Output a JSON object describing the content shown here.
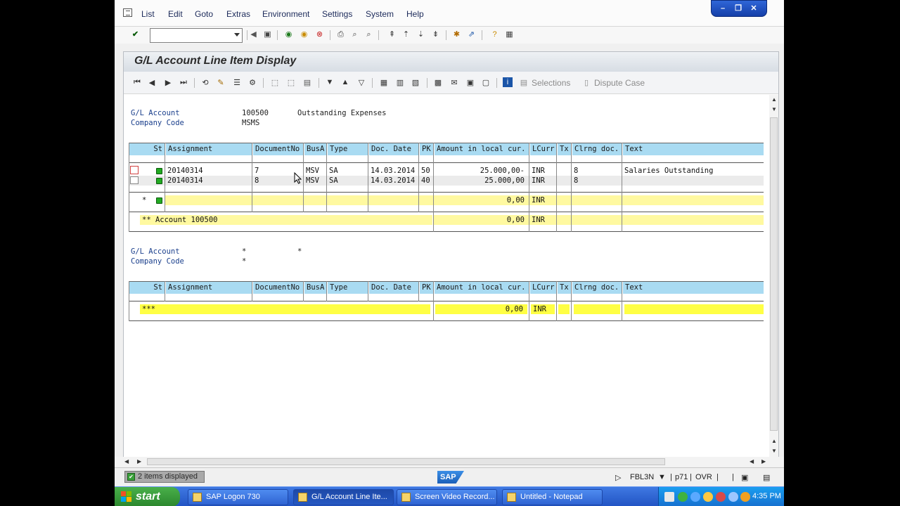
{
  "menubar": {
    "items": [
      "List",
      "Edit",
      "Goto",
      "Extras",
      "Environment",
      "Settings",
      "System",
      "Help"
    ],
    "underline": [
      "L",
      "E",
      "G",
      "x",
      "v",
      "S",
      "y",
      "H"
    ]
  },
  "command_field": {
    "value": ""
  },
  "screen": {
    "title": "G/L Account Line Item Display",
    "toolbar": {
      "selections_label": "Selections",
      "dispute_label": "Dispute Case"
    }
  },
  "block1": {
    "gl_account_label": "G/L Account",
    "gl_account_value": "100500",
    "gl_account_desc": "Outstanding Expenses",
    "company_code_label": "Company Code",
    "company_code_value": "MSMS"
  },
  "columns": [
    "St",
    "Assignment",
    "DocumentNo",
    "BusA",
    "Type",
    "Doc. Date",
    "PK",
    "Amount in local cur.",
    "LCurr",
    "Tx",
    "Clrng doc.",
    "Text"
  ],
  "rows": [
    {
      "assignment": "20140314",
      "doc_no": "7",
      "busa": "MSV",
      "type": "SA",
      "doc_date": "14.03.2014",
      "pk": "50",
      "amount": "25.000,00-",
      "lcurr": "INR",
      "tx": "",
      "clrng": "8",
      "text": "Salaries Outstanding"
    },
    {
      "assignment": "20140314",
      "doc_no": "8",
      "busa": "MSV",
      "type": "SA",
      "doc_date": "14.03.2014",
      "pk": "40",
      "amount": "25.000,00",
      "lcurr": "INR",
      "tx": "",
      "clrng": "8",
      "text": ""
    }
  ],
  "subtotal1": {
    "marker": "*",
    "amount": "0,00",
    "lcurr": "INR"
  },
  "account_total": {
    "label": "** Account 100500",
    "amount": "0,00",
    "lcurr": "INR"
  },
  "block2": {
    "gl_account_label": "G/L Account",
    "gl_account_value": "*",
    "gl_account_extra": "*",
    "company_code_label": "Company Code",
    "company_code_value": "*"
  },
  "grand_total": {
    "label": "***",
    "amount": "0,00",
    "lcurr": "INR"
  },
  "statusbar": {
    "message": "2 items displayed",
    "logo": "SAP",
    "transaction": "FBL3N",
    "server": "p71",
    "mode": "OVR"
  },
  "taskbar": {
    "start": "start",
    "tasks": [
      "SAP Logon 730",
      "G/L Account Line Ite...",
      "Screen Video Record...",
      "Untitled - Notepad"
    ],
    "clock": "4:35 PM"
  },
  "colors": {
    "header_blue": "#a9dbf2",
    "total_yellow": "#ffff44",
    "label_blue": "#1a3f8c",
    "led_green": "#22aa22",
    "taskbar_blue": "#2254c4"
  }
}
